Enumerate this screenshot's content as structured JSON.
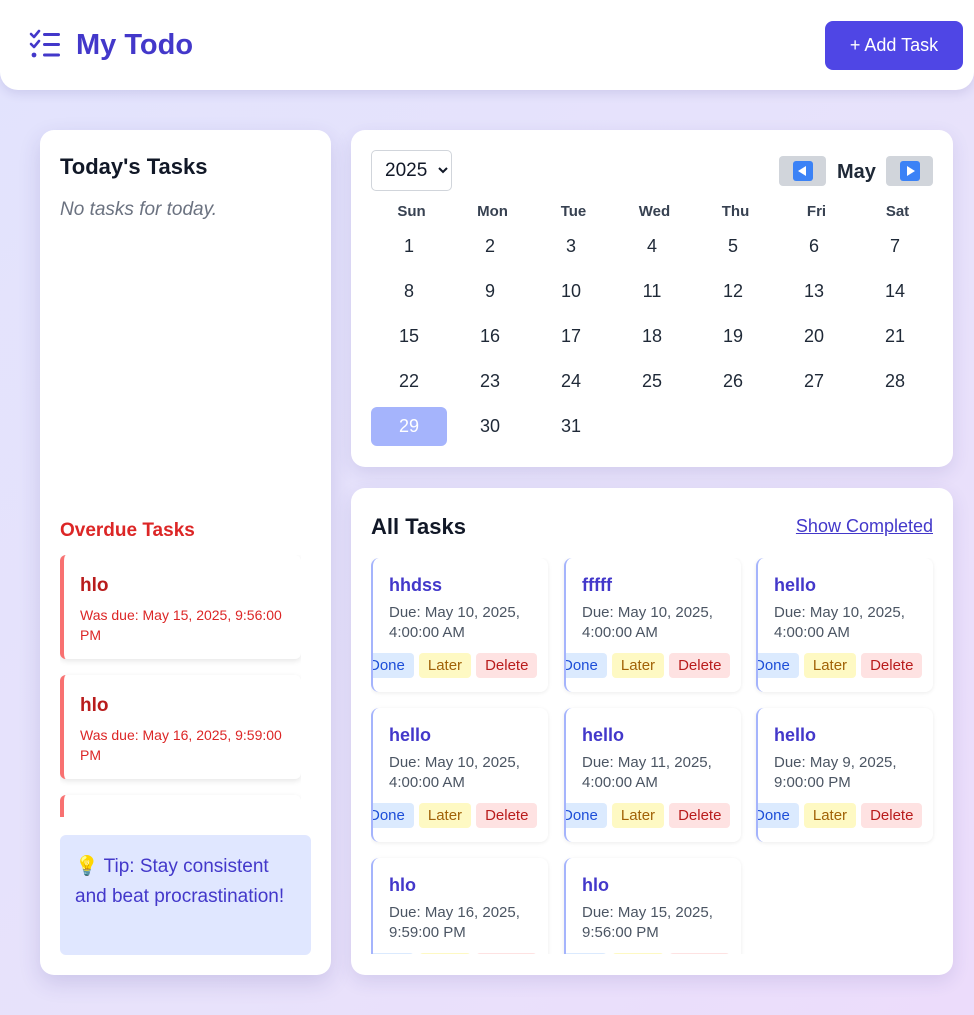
{
  "header": {
    "title": "My Todo",
    "add_label": "+ Add Task",
    "icon": "checklist-icon"
  },
  "today": {
    "title": "Today's Tasks",
    "empty": "No tasks for today."
  },
  "overdue": {
    "title": "Overdue Tasks",
    "items": [
      {
        "title": "hlo",
        "due": "Was due: May 15, 2025, 9:56:00 PM"
      },
      {
        "title": "hlo",
        "due": "Was due: May 16, 2025, 9:59:00 PM"
      },
      {
        "title": "",
        "due": ""
      }
    ]
  },
  "tip": {
    "icon": "lightbulb-icon",
    "text": "💡 Tip: Stay consistent and beat procrastination!"
  },
  "calendar": {
    "year": "2025",
    "month": "May",
    "weekdays": [
      "Sun",
      "Mon",
      "Tue",
      "Wed",
      "Thu",
      "Fri",
      "Sat"
    ],
    "weeks": [
      [
        "1",
        "2",
        "3",
        "4",
        "5",
        "6",
        "7"
      ],
      [
        "8",
        "9",
        "10",
        "11",
        "12",
        "13",
        "14"
      ],
      [
        "15",
        "16",
        "17",
        "18",
        "19",
        "20",
        "21"
      ],
      [
        "22",
        "23",
        "24",
        "25",
        "26",
        "27",
        "28"
      ],
      [
        "29",
        "30",
        "31",
        "",
        "",
        "",
        ""
      ]
    ],
    "selected": "29",
    "colors": {
      "selected": "#a5b4fc",
      "nav": "#3b82f6"
    }
  },
  "all_tasks": {
    "title": "All Tasks",
    "show_completed": "Show Completed",
    "actions": {
      "done": "Done",
      "later": "Later",
      "delete": "Delete"
    },
    "items": [
      {
        "title": "hhdss",
        "due": "Due: May 10, 2025, 4:00:00 AM"
      },
      {
        "title": "fffff",
        "due": "Due: May 10, 2025, 4:00:00 AM"
      },
      {
        "title": "hello",
        "due": "Due: May 10, 2025, 4:00:00 AM"
      },
      {
        "title": "hello",
        "due": "Due: May 10, 2025, 4:00:00 AM"
      },
      {
        "title": "hello",
        "due": "Due: May 11, 2025, 4:00:00 AM"
      },
      {
        "title": "hello",
        "due": "Due: May 9, 2025, 9:00:00 PM"
      },
      {
        "title": "hlo",
        "due": "Due: May 16, 2025, 9:59:00 PM"
      },
      {
        "title": "hlo",
        "due": "Due: May 15, 2025, 9:56:00 PM"
      }
    ]
  },
  "colors": {
    "accent": "#4f46e5",
    "brand_text": "#4338ca",
    "overdue": "#dc2626"
  }
}
